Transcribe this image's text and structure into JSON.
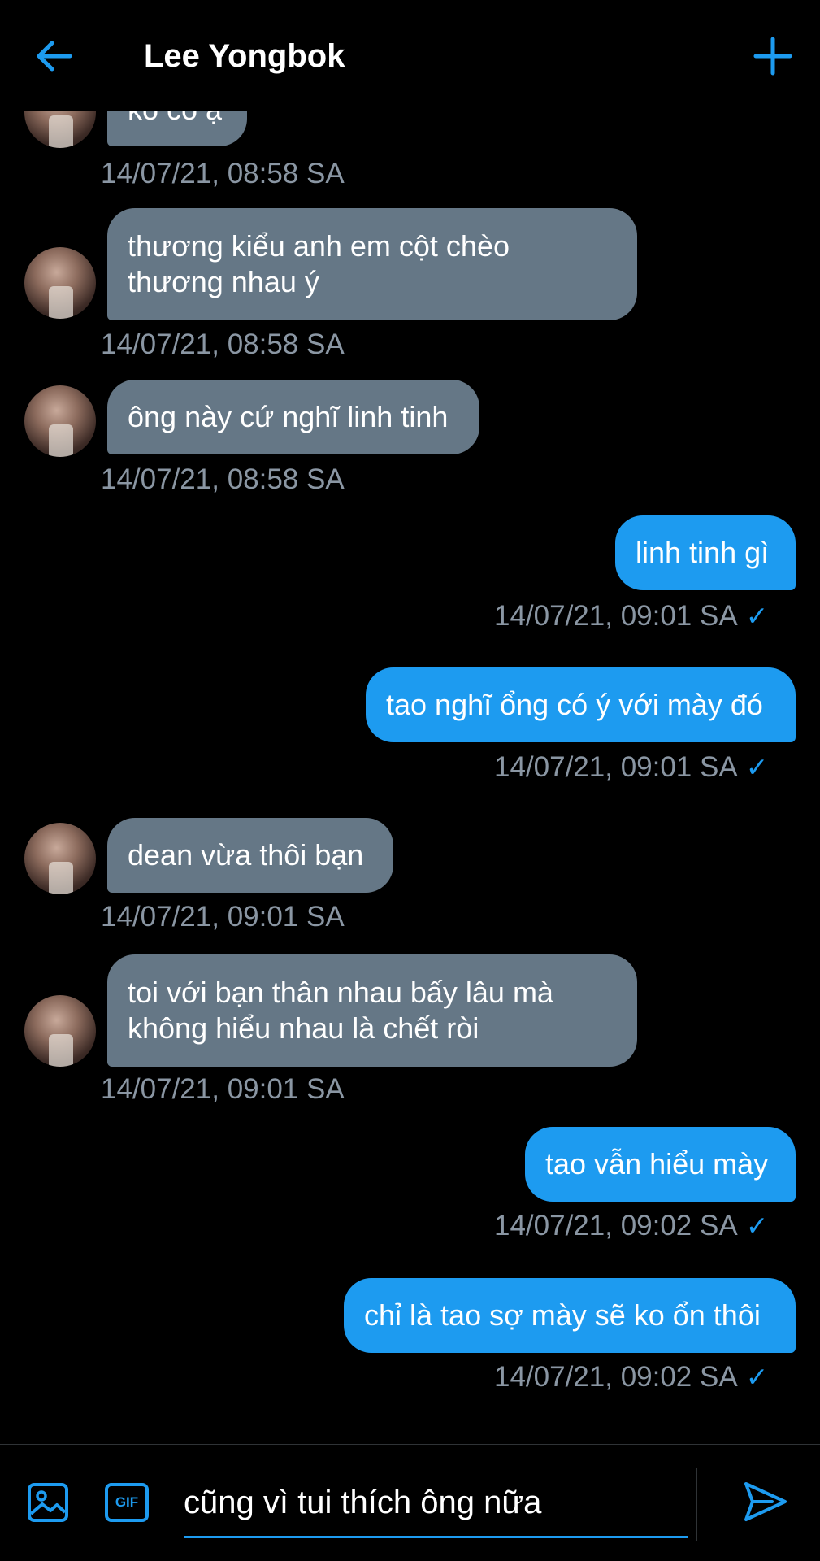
{
  "header": {
    "title": "Lee Yongbok"
  },
  "colors": {
    "accent": "#1d9bf0",
    "incoming_bubble": "#657786",
    "timestamp": "#8a96a3",
    "background": "#000000"
  },
  "messages": [
    {
      "direction": "in",
      "lines": [
        "ko có ạ"
      ],
      "timestamp": "14/07/21, 08:58 SA"
    },
    {
      "direction": "in",
      "lines": [
        "thương kiểu anh em cột chèo",
        "thương nhau ý"
      ],
      "timestamp": "14/07/21, 08:58 SA"
    },
    {
      "direction": "in",
      "lines": [
        "ông này cứ nghĩ linh tinh"
      ],
      "timestamp": "14/07/21, 08:58 SA"
    },
    {
      "direction": "out",
      "lines": [
        "linh tinh gì"
      ],
      "timestamp": "14/07/21, 09:01 SA",
      "read_icon": "✓"
    },
    {
      "direction": "out",
      "lines": [
        "tao nghĩ ổng có ý với mày đó"
      ],
      "timestamp": "14/07/21, 09:01 SA",
      "read_icon": "✓"
    },
    {
      "direction": "in",
      "lines": [
        "dean vừa thôi bạn"
      ],
      "timestamp": "14/07/21, 09:01 SA"
    },
    {
      "direction": "in",
      "lines": [
        "toi với bạn thân nhau bấy lâu mà",
        "không hiểu nhau là chết ròi"
      ],
      "timestamp": "14/07/21, 09:01 SA"
    },
    {
      "direction": "out",
      "lines": [
        "tao vẫn hiểu mày"
      ],
      "timestamp": "14/07/21, 09:02 SA",
      "read_icon": "✓"
    },
    {
      "direction": "out",
      "lines": [
        "chỉ là tao sợ mày sẽ ko ổn thôi"
      ],
      "timestamp": "14/07/21, 09:02 SA",
      "read_icon": "✓"
    }
  ],
  "composer": {
    "value": "cũng vì tui thích ông nữa",
    "gif_label": "GIF",
    "icons": [
      "image-icon",
      "gif-icon",
      "send-icon"
    ]
  }
}
